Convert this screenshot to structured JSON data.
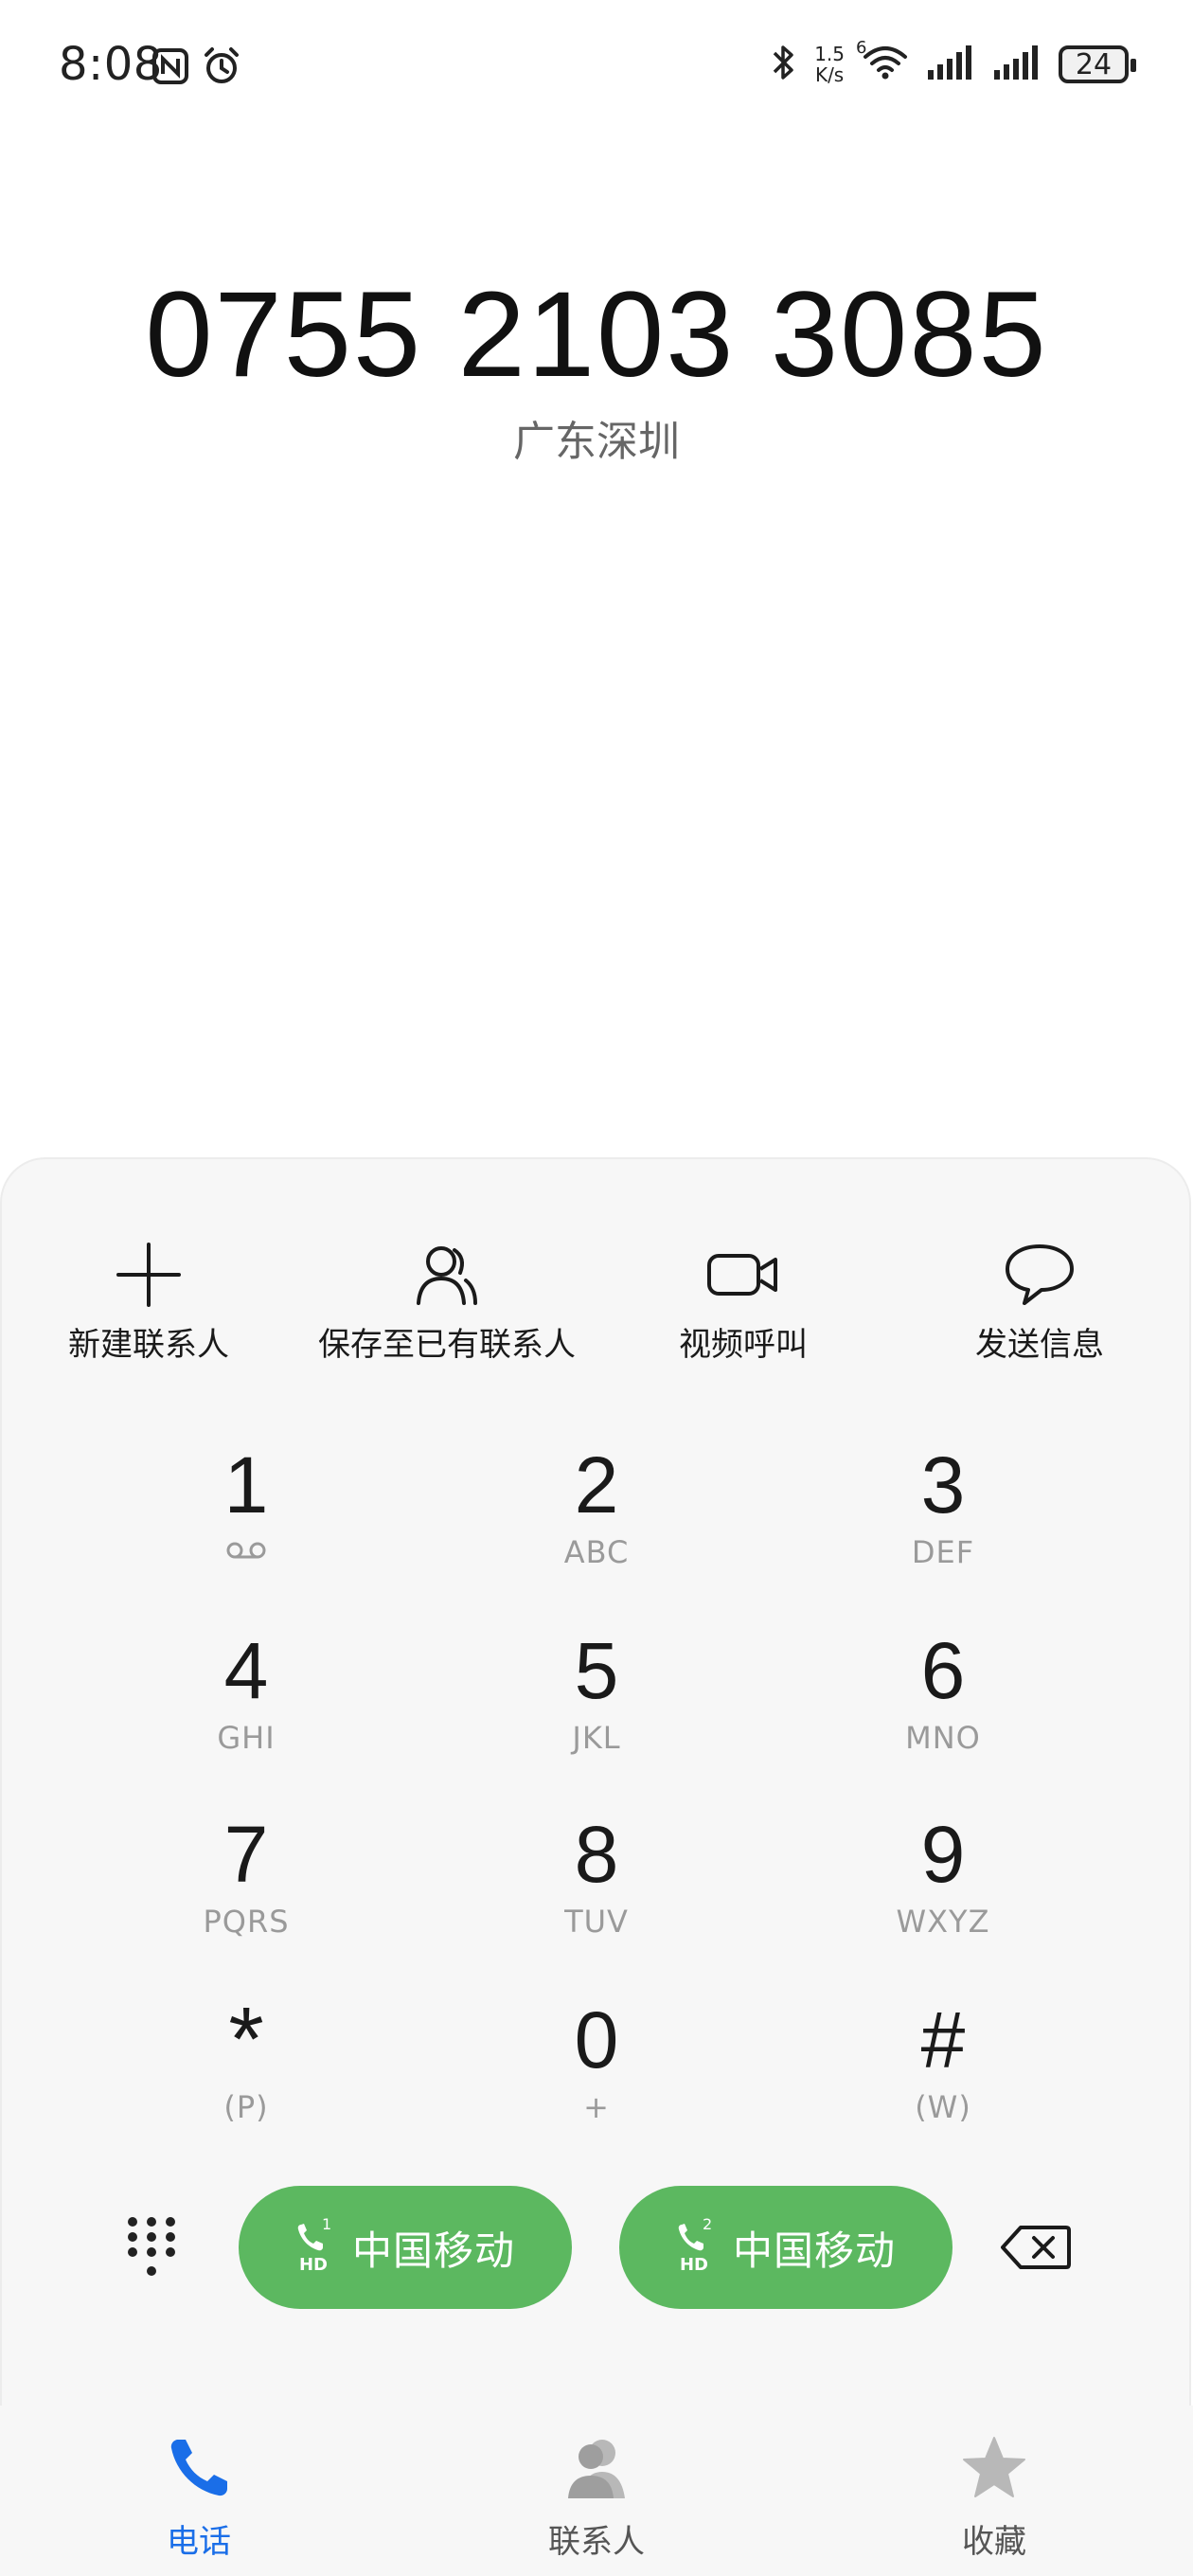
{
  "status_bar": {
    "time": "8:08",
    "speed_value": "1.5",
    "speed_unit": "K/s",
    "wifi_label": "6",
    "battery": "24"
  },
  "call": {
    "number": "0755 2103 3085",
    "location": "广东深圳"
  },
  "actions": [
    {
      "label": "新建联系人",
      "icon": "plus-icon"
    },
    {
      "label": "保存至已有联系人",
      "icon": "contact-icon"
    },
    {
      "label": "视频呼叫",
      "icon": "video-call-icon"
    },
    {
      "label": "发送信息",
      "icon": "message-icon"
    }
  ],
  "keypad": [
    {
      "digit": "1",
      "sub": ""
    },
    {
      "digit": "2",
      "sub": "ABC"
    },
    {
      "digit": "3",
      "sub": "DEF"
    },
    {
      "digit": "4",
      "sub": "GHI"
    },
    {
      "digit": "5",
      "sub": "JKL"
    },
    {
      "digit": "6",
      "sub": "MNO"
    },
    {
      "digit": "7",
      "sub": "PQRS"
    },
    {
      "digit": "8",
      "sub": "TUV"
    },
    {
      "digit": "9",
      "sub": "WXYZ"
    },
    {
      "digit": "*",
      "sub": "(P)"
    },
    {
      "digit": "0",
      "sub": "+"
    },
    {
      "digit": "#",
      "sub": "(W)"
    }
  ],
  "call_buttons": [
    {
      "sim": "1",
      "hd": "HD",
      "carrier": "中国移动"
    },
    {
      "sim": "2",
      "hd": "HD",
      "carrier": "中国移动"
    }
  ],
  "bottom_nav": [
    {
      "label": "电话",
      "icon": "phone-icon",
      "active": true
    },
    {
      "label": "联系人",
      "icon": "person-icon",
      "active": false
    },
    {
      "label": "收藏",
      "icon": "star-icon",
      "active": false
    }
  ],
  "colors": {
    "call_green": "#5cb860",
    "active_blue": "#1a6ee8"
  }
}
